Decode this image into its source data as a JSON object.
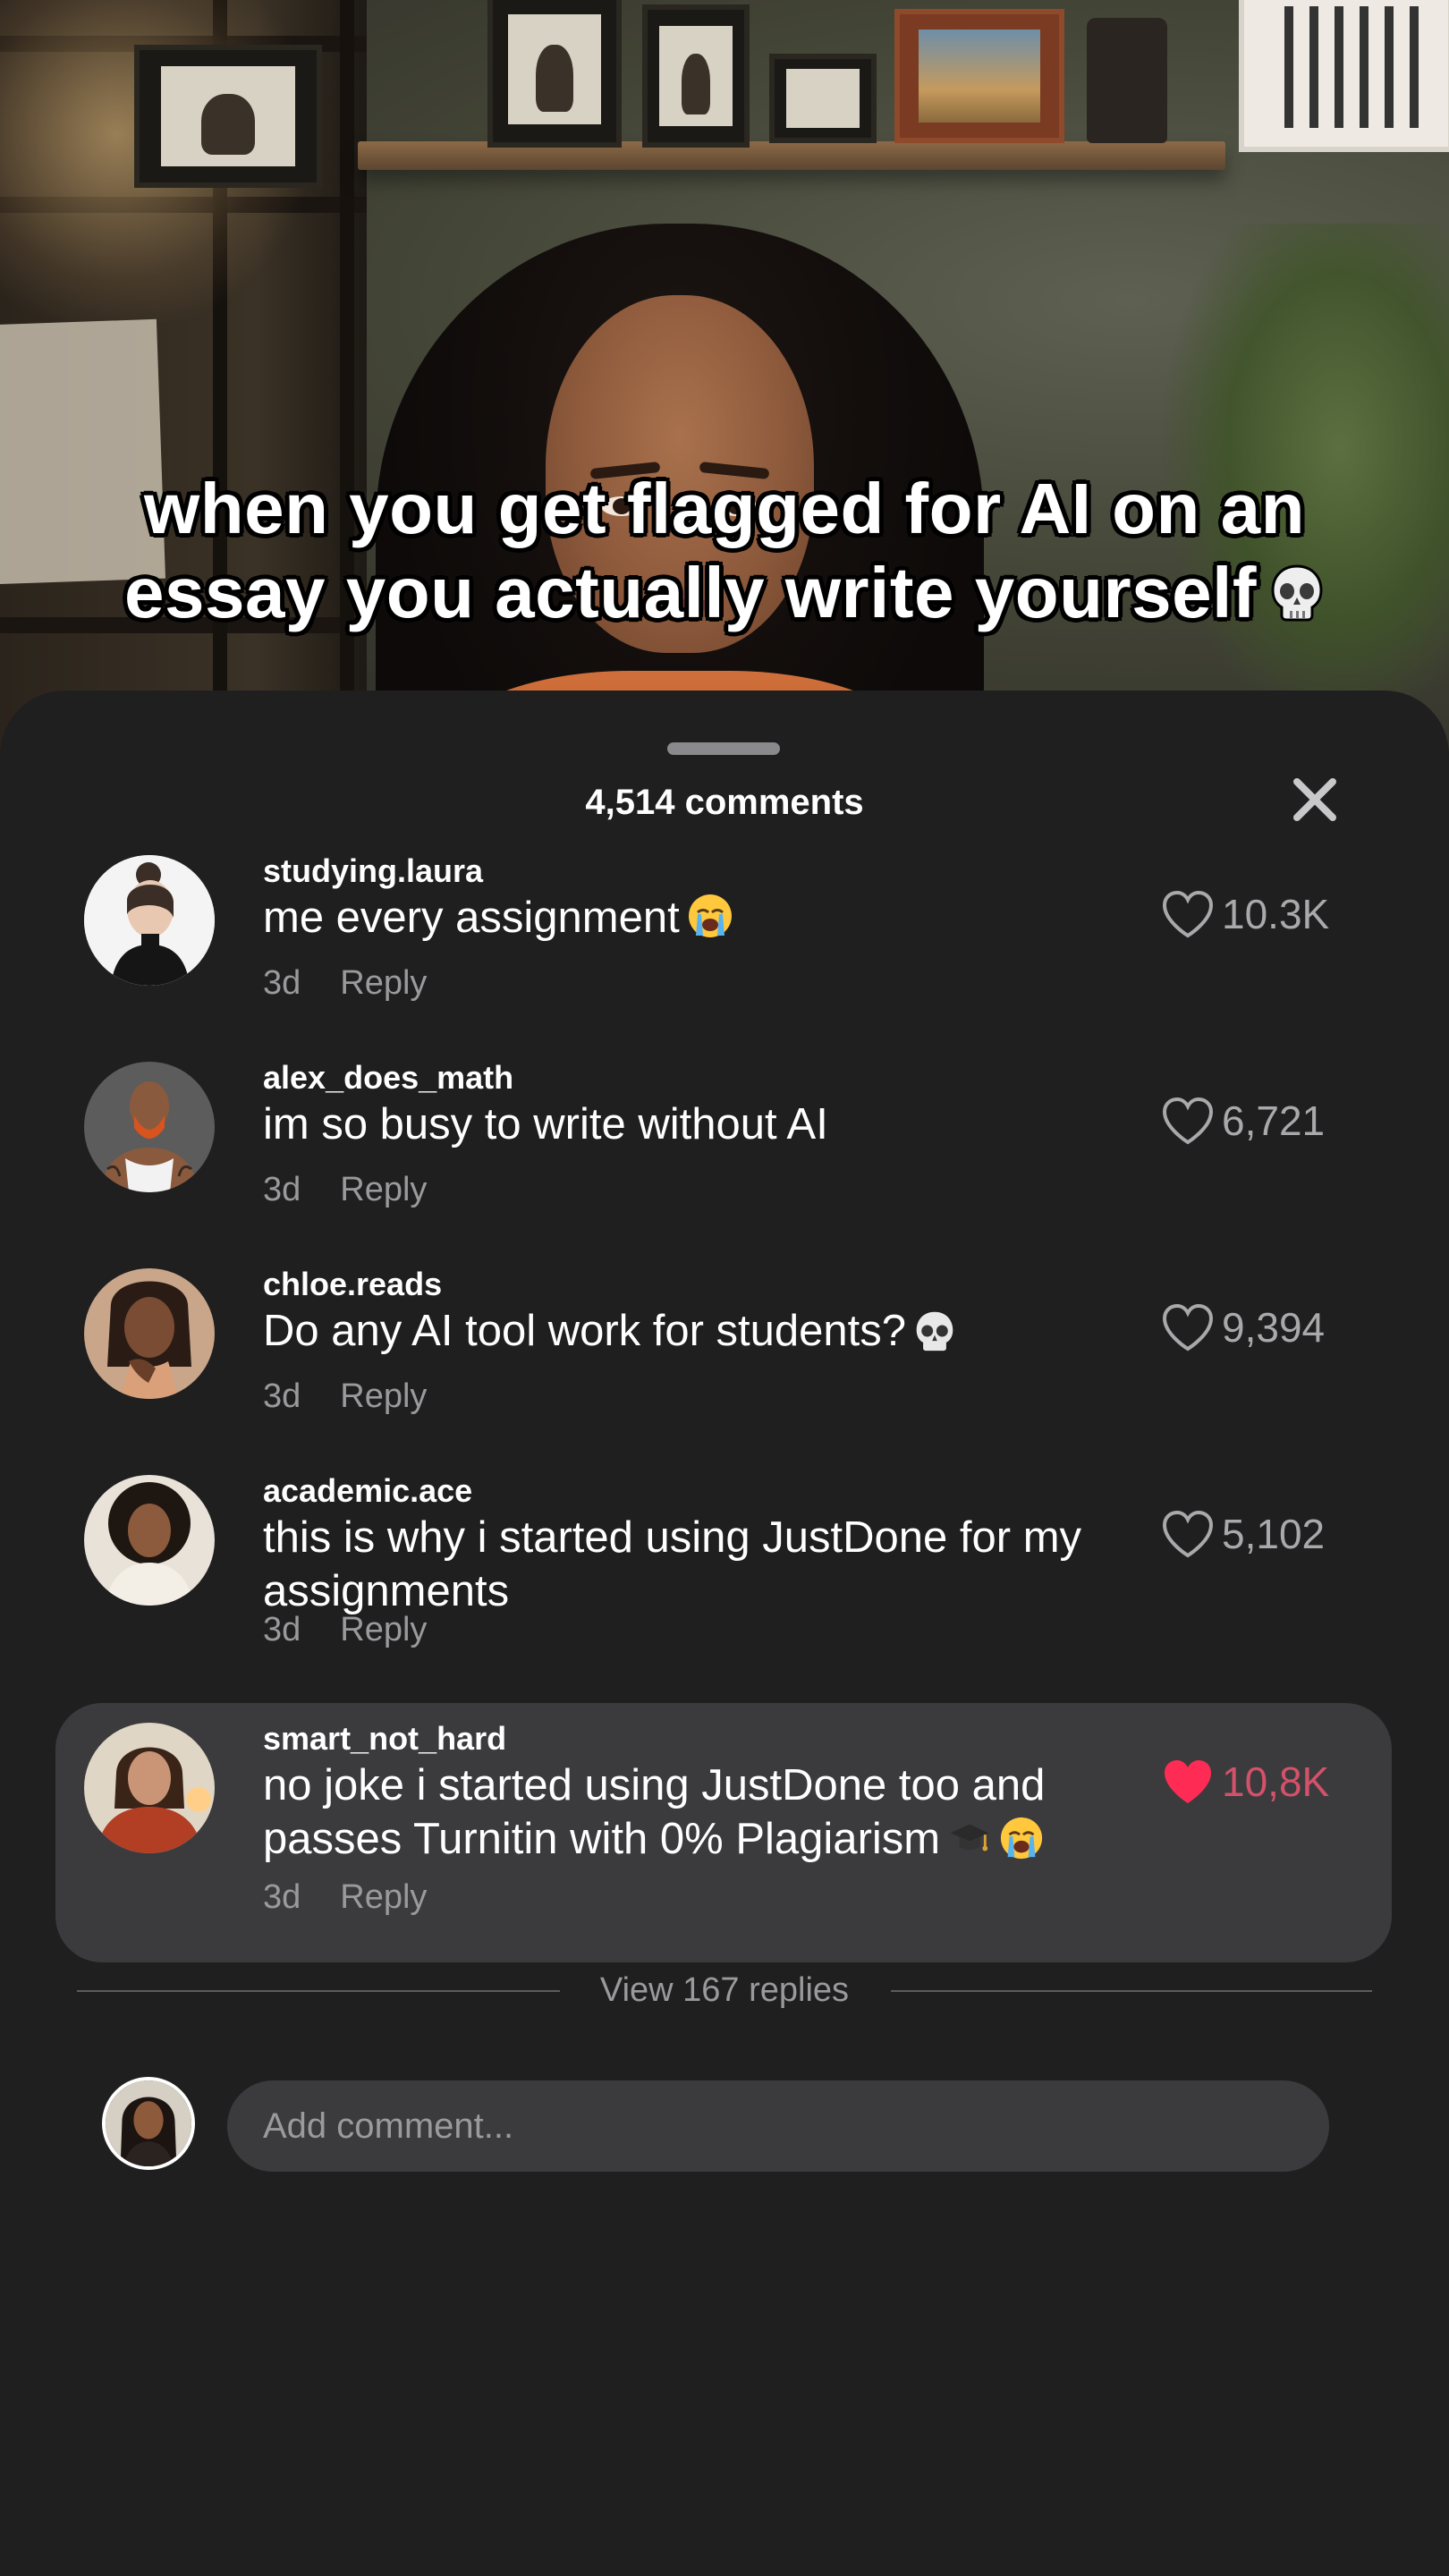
{
  "video": {
    "caption_line1": "when you get flagged for AI on an",
    "caption_line2": "essay you actually write yourself"
  },
  "sheet": {
    "title": "4,514 comments"
  },
  "comments": [
    {
      "username": "studying.laura",
      "text": "me every assignment",
      "time": "3d",
      "reply": "Reply",
      "likes": "10.3K",
      "liked": false,
      "emoji": [
        "loudly-crying-face"
      ]
    },
    {
      "username": "alex_does_math",
      "text": "im so busy to write without AI",
      "time": "3d",
      "reply": "Reply",
      "likes": "6,721",
      "liked": false,
      "emoji": []
    },
    {
      "username": "chloe.reads",
      "text": "Do any AI tool work for students?",
      "time": "3d",
      "reply": "Reply",
      "likes": "9,394",
      "liked": false,
      "emoji": [
        "skull"
      ]
    },
    {
      "username": "academic.ace",
      "text": "this is why i started using JustDone for my assignments",
      "time": "3d",
      "reply": "Reply",
      "likes": "5,102",
      "liked": false,
      "emoji": []
    },
    {
      "username": "smart_not_hard",
      "text": "no joke i started using JustDone too and passes Turnitin with 0% Plagiarism",
      "time": "3d",
      "reply": "Reply",
      "likes": "10,8K",
      "liked": true,
      "emoji": [
        "graduation-cap",
        "loudly-crying-face"
      ]
    }
  ],
  "replies": {
    "label": "View 167 replies"
  },
  "compose": {
    "placeholder": "Add comment..."
  },
  "colors": {
    "like_active": "#fe2c55",
    "like_count_active": "#d4516a",
    "sheet_bg": "#1f1f20",
    "highlight_bg": "#3b3b3d"
  }
}
